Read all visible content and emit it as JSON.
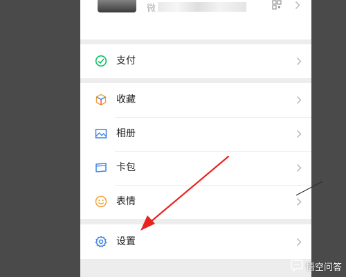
{
  "profile": {
    "wechat_id_prefix": "微",
    "icons": {
      "qr": "qr-code-icon",
      "arrow": "chevron-right-icon"
    }
  },
  "menu": {
    "pay": {
      "label": "支付",
      "icon": "wechat-pay-icon",
      "color": "#07c160"
    },
    "items": [
      {
        "label": "收藏",
        "icon": "favorites-cube-icon",
        "color": "#f0a23a"
      },
      {
        "label": "相册",
        "icon": "album-picture-icon",
        "color": "#3d83e6"
      },
      {
        "label": "卡包",
        "icon": "card-wallet-icon",
        "color": "#3d83e6"
      },
      {
        "label": "表情",
        "icon": "sticker-smiley-icon",
        "color": "#f0a23a"
      }
    ],
    "settings": {
      "label": "设置",
      "icon": "settings-gear-icon",
      "color": "#3d83e6"
    }
  },
  "annotation": {
    "arrow_color": "#e8231f"
  },
  "watermark": {
    "text": "悟空问答"
  }
}
